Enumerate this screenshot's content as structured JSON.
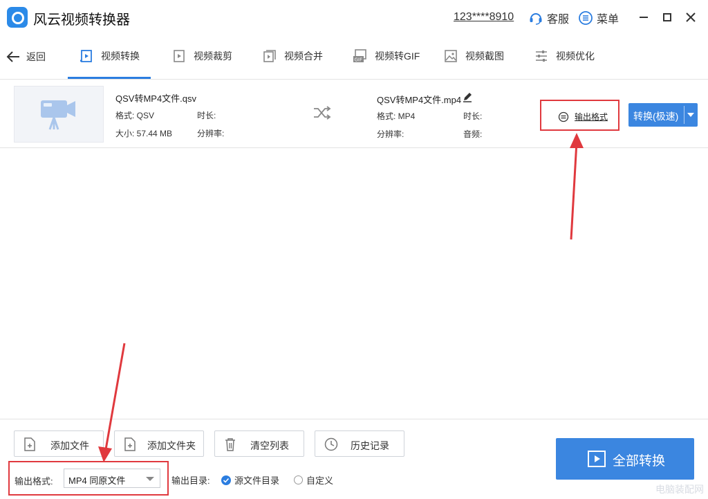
{
  "app": {
    "title": "风云视频转换器",
    "account": "123****8910",
    "service_label": "客服",
    "menu_label": "菜单"
  },
  "nav": {
    "back_label": "返回",
    "tabs": [
      {
        "label": "视频转换",
        "icon": "video-convert-icon",
        "active": true
      },
      {
        "label": "视频裁剪",
        "icon": "video-crop-icon"
      },
      {
        "label": "视频合并",
        "icon": "video-merge-icon"
      },
      {
        "label": "视频转GIF",
        "icon": "gif-icon"
      },
      {
        "label": "视频截图",
        "icon": "image-icon"
      },
      {
        "label": "视频优化",
        "icon": "sliders-icon"
      }
    ]
  },
  "file": {
    "source": {
      "name": "QSV转MP4文件.qsv",
      "format": "格式: QSV",
      "size": "大小: 57.44 MB",
      "duration": "时长:",
      "resolution": "分辨率:"
    },
    "target": {
      "name": "QSV转MP4文件.mp4",
      "format": "格式: MP4",
      "duration": "时长:",
      "resolution": "分辨率:",
      "audio": "音频:"
    },
    "output_format_label": "输出格式",
    "convert_label": "转换(极速)"
  },
  "bottom": {
    "buttons": {
      "add_file": "添加文件",
      "add_folder": "添加文件夹",
      "clear_list": "清空列表",
      "history": "历史记录"
    },
    "output_format_label": "输出格式:",
    "output_format_value": "MP4 同原文件",
    "output_dir_label": "输出目录:",
    "dir_source": "源文件目录",
    "dir_custom": "自定义",
    "convert_all": "全部转换",
    "watermark": "电脑装配网"
  },
  "colors": {
    "accent": "#3b86e0",
    "highlight": "#e0393e"
  }
}
